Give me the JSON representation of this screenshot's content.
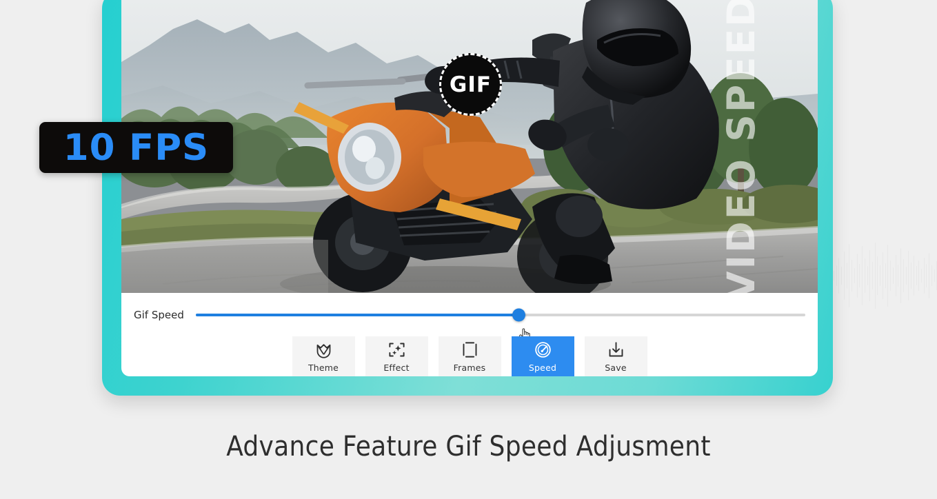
{
  "badges": {
    "fps": "10 FPS",
    "gif": "GIF",
    "watermark": "VIDEO SPEED"
  },
  "slider": {
    "label": "Gif Speed",
    "value_percent": 53,
    "fill_color": "#1e7fe0",
    "track_color": "#d6d6d6",
    "cursor_icon": "pointing-hand-cursor"
  },
  "toolbar": {
    "buttons": [
      {
        "label": "Theme",
        "icon": "tulip-icon",
        "active": false
      },
      {
        "label": "Effect",
        "icon": "sparkle-icon",
        "active": false
      },
      {
        "label": "Frames",
        "icon": "frame-icon",
        "active": false
      },
      {
        "label": "Speed",
        "icon": "speedometer-icon",
        "active": true
      },
      {
        "label": "Save",
        "icon": "download-icon",
        "active": false
      }
    ],
    "active_color": "#2d8cf0",
    "inactive_color": "#f4f4f4"
  },
  "caption": "Advance Feature Gif Speed Adjusment",
  "colors": {
    "background": "#efefef",
    "frame_teal": "#4ed6d0",
    "accent_blue": "#2a8cf7",
    "badge_black": "#0d0b0a"
  },
  "photo": {
    "description": "Motorcyclist on orange sport motorcycle riding a mountain road"
  }
}
